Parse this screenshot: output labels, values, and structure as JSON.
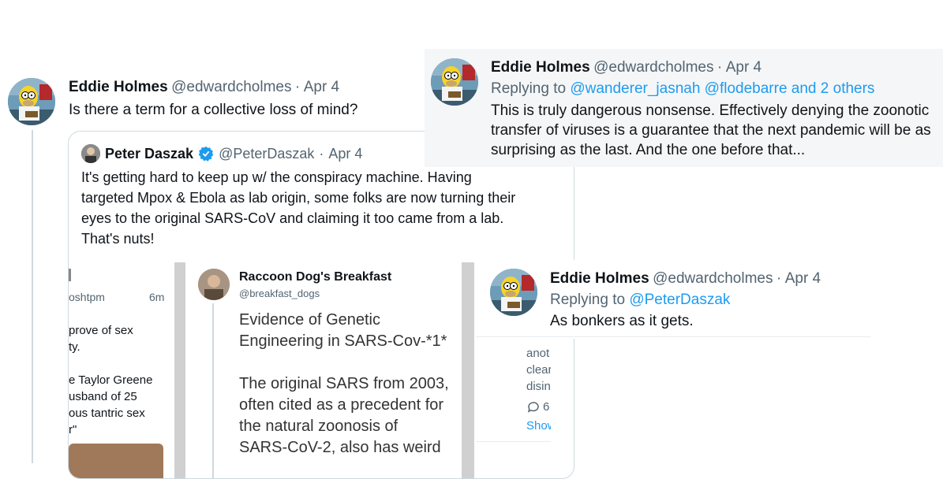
{
  "tweet_main": {
    "name": "Eddie Holmes",
    "handle": "@edwardcholmes",
    "dot": "·",
    "date": "Apr 4",
    "text": "Is there a term for a collective loss of mind?"
  },
  "quote": {
    "name": "Peter Daszak",
    "handle": "@PeterDaszak",
    "dot": "·",
    "date": "Apr 4",
    "text_lines": [
      "It's getting hard to keep up w/ the conspiracy machine. Having",
      "targeted Mpox & Ebola as lab origin, some folks are now turning their",
      "eyes to the original SARS-CoV and claiming it too came from a lab.",
      "That's nuts!"
    ],
    "embed_left": {
      "handle_frag": "oshtpm",
      "time": "6m",
      "lines": [
        "prove of sex",
        "ty.",
        "",
        "e Taylor Greene",
        "usband of 25",
        "ous tantric sex",
        "r\""
      ]
    },
    "embed_mid": {
      "name": "Raccoon Dog's Breakfast",
      "handle": "@breakfast_dogs",
      "lines": [
        "Evidence of Genetic",
        "Engineering in SARS-Cov-*1*",
        "",
        "The original SARS from 2003,",
        "often cited as a precedent for",
        "the natural zoonosis of",
        "SARS-CoV-2, also has weird"
      ]
    }
  },
  "tweet_reply1": {
    "name": "Eddie Holmes",
    "handle": "@edwardcholmes",
    "dot": "·",
    "date": "Apr 4",
    "replying_label": "Replying to",
    "replying_to": "@wanderer_jasnah @flodebarre and 2 others",
    "text_lines": [
      "This is truly dangerous nonsense. Effectively denying the zoonotic",
      "transfer of viruses is a guarantee that the next pandemic will be as",
      "surprising as the last. And the one before that..."
    ]
  },
  "tweet_reply2": {
    "name": "Eddie Holmes",
    "handle": "@edwardcholmes",
    "dot": "·",
    "date": "Apr 4",
    "replying_label": "Replying to",
    "replying_to": "@PeterDaszak",
    "text": "As bonkers as it gets."
  },
  "snippet": {
    "lines": [
      "anot",
      "clear",
      "disin"
    ],
    "reply_count": "6",
    "show_more": "Show"
  },
  "colors": {
    "link": "#1d9bf0",
    "muted": "#536471",
    "verified": "#1d9bf0"
  }
}
